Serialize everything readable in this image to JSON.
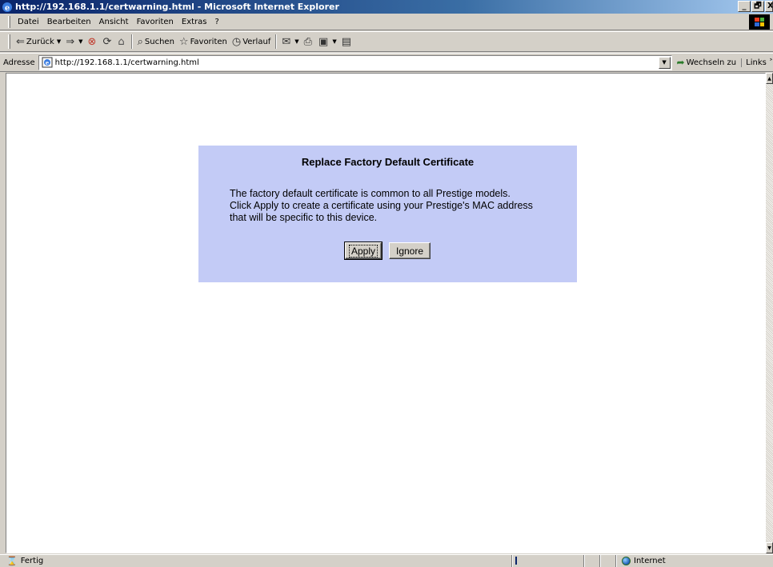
{
  "window": {
    "title": "http://192.168.1.1/certwarning.html - Microsoft Internet Explorer",
    "minimize": "_",
    "maximize": "🗗",
    "close": "X"
  },
  "menu": [
    "Datei",
    "Bearbeiten",
    "Ansicht",
    "Favoriten",
    "Extras",
    "?"
  ],
  "toolbar": {
    "back": "Zurück",
    "search": "Suchen",
    "favorites": "Favoriten",
    "history": "Verlauf"
  },
  "address": {
    "label": "Adresse",
    "url": "http://192.168.1.1/certwarning.html",
    "go": "Wechseln zu",
    "links": "Links ˃"
  },
  "dialog": {
    "title": "Replace Factory Default Certificate",
    "lines": [
      "The factory default certificate is common to all Prestige models.",
      "Click Apply to create a certificate using your Prestige's MAC address",
      "that will be specific to this device."
    ],
    "apply": "Apply",
    "ignore": "Ignore",
    "background": "#c3cbf6"
  },
  "status": {
    "text": "Fertig",
    "zone": "Internet"
  },
  "colors": {
    "titlebar_start": "#0a246a",
    "titlebar_end": "#a6caf0",
    "chrome": "#d4d0c8"
  }
}
